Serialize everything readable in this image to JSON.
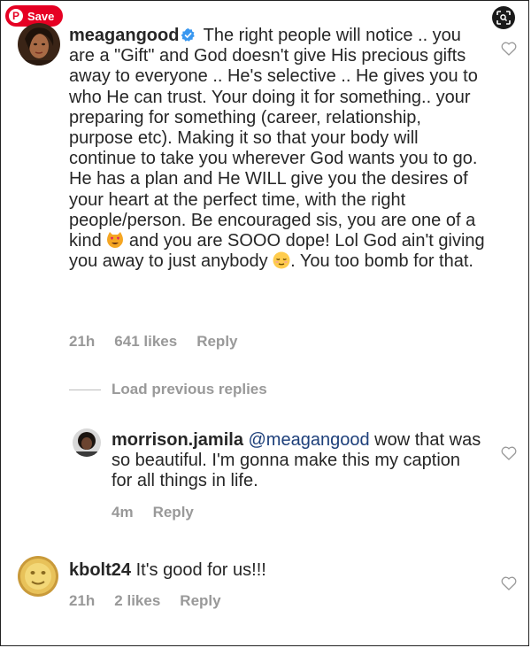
{
  "save_button": {
    "label": "Save",
    "icon": "pinterest-logo-icon"
  },
  "lens_button": {
    "icon": "visual-search-icon"
  },
  "comments": [
    {
      "username": "meagangood",
      "verified": true,
      "text_part1": "The right people will notice .. you are a \"Gift\" and God doesn't give His precious gifts away to everyone .. He's selective .. He gives you to who He can trust. Your doing it for something.. your preparing for something (career, relationship, purpose etc). Making it so that your body will continue to take you wherever God wants you to go. He has a plan and He WILL give you the desires of your heart at the perfect time, with the right people/person. Be encouraged sis, you are one of a kind",
      "emoji1": "heart-eyes-cat-emoji",
      "text_part2": "and you are SOOO dope! Lol God ain't giving you away to just anybody",
      "emoji2": "relieved-face-emoji",
      "text_part3": ". You too bomb for that.",
      "time": "21h",
      "likes": "641 likes",
      "reply": "Reply"
    },
    {
      "username": "morrison.jamila",
      "mention": "@meagangood",
      "text": "wow that was so beautiful. I'm gonna make this my caption for all things in life.",
      "time": "4m",
      "reply": "Reply"
    },
    {
      "username": "kbolt24",
      "text": "It's good for us!!!",
      "time": "21h",
      "likes": "2 likes",
      "reply": "Reply"
    }
  ],
  "load_previous": "Load previous replies",
  "colors": {
    "pinterest_red": "#e60023",
    "verified_blue": "#3897f0",
    "meta_gray": "#999999",
    "mention_blue": "#1d3f7a"
  }
}
